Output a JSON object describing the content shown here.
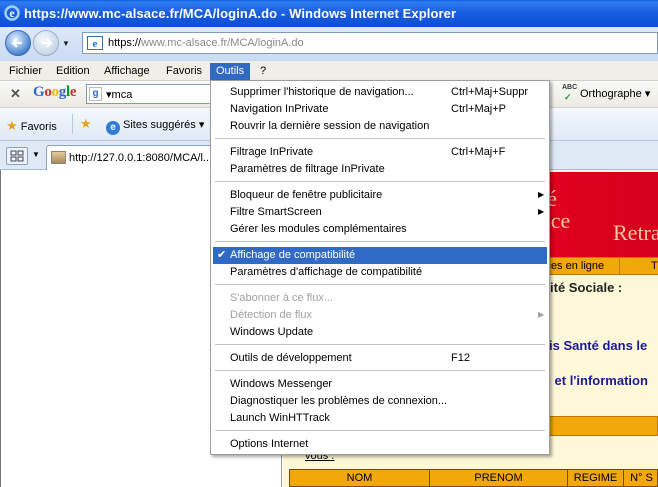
{
  "window": {
    "title": "https://www.mc-alsace.fr/MCA/loginA.do - Windows Internet Explorer"
  },
  "address": {
    "url_prefix": "https://",
    "url_domain": "www.mc-alsace.fr",
    "url_path": "/MCA/loginA.do"
  },
  "menubar": {
    "items": [
      "Fichier",
      "Edition",
      "Affichage",
      "Favoris",
      "Outils",
      "?"
    ],
    "active": "Outils"
  },
  "google_toolbar": {
    "logo": "Google",
    "search_value": "mca",
    "spelling_label": "Orthographe",
    "spelling_icon_text": "ABC"
  },
  "favorites_bar": {
    "favorites_label": "Favoris",
    "suggested_label": "Sites suggérés"
  },
  "tab": {
    "label": "http://127.0.0.1:8080/MCA/l..."
  },
  "page": {
    "banner_line1": "té",
    "banner_line2": "yance",
    "banner_line3": "Retra",
    "nav_link1": "ices en ligne",
    "nav_link2": "T",
    "securite": "urité Sociale :",
    "line1": "is Santé dans le",
    "line2": "n et l'information",
    "vous": "vous :",
    "table_headers": [
      "NOM",
      "PRENOM",
      "REGIME",
      "N° S"
    ]
  },
  "tools_menu": {
    "items": [
      {
        "label": "Supprimer l'historique de navigation...",
        "shortcut": "Ctrl+Maj+Suppr"
      },
      {
        "label": "Navigation InPrivate",
        "shortcut": "Ctrl+Maj+P"
      },
      {
        "label": "Rouvrir la dernière session de navigation",
        "shortcut": ""
      },
      {
        "label": "Filtrage InPrivate",
        "shortcut": "Ctrl+Maj+F"
      },
      {
        "label": "Paramètres de filtrage InPrivate",
        "shortcut": ""
      },
      {
        "label": "Bloqueur de fenêtre publicitaire",
        "shortcut": "",
        "submenu": true
      },
      {
        "label": "Filtre SmartScreen",
        "shortcut": "",
        "submenu": true
      },
      {
        "label": "Gérer les modules complémentaires",
        "shortcut": ""
      },
      {
        "label": "Affichage de compatibilité",
        "shortcut": "",
        "checked": true,
        "highlighted": true
      },
      {
        "label": "Paramètres d'affichage de compatibilité",
        "shortcut": ""
      },
      {
        "label": "S'abonner à ce flux...",
        "shortcut": "",
        "disabled": true
      },
      {
        "label": "Détection de flux",
        "shortcut": "",
        "disabled": true,
        "submenu": true
      },
      {
        "label": "Windows Update",
        "shortcut": ""
      },
      {
        "label": "Outils de développement",
        "shortcut": "F12"
      },
      {
        "label": "Windows Messenger",
        "shortcut": ""
      },
      {
        "label": "Diagnostiquer les problèmes de connexion...",
        "shortcut": ""
      },
      {
        "label": "Launch WinHTTrack",
        "shortcut": ""
      },
      {
        "label": "Options Internet",
        "shortcut": ""
      }
    ]
  },
  "colors": {
    "titlebar": "#0a4fd4",
    "menu_highlight": "#316ac5",
    "banner_red": "#e8001f",
    "orange": "#f2a70a"
  }
}
